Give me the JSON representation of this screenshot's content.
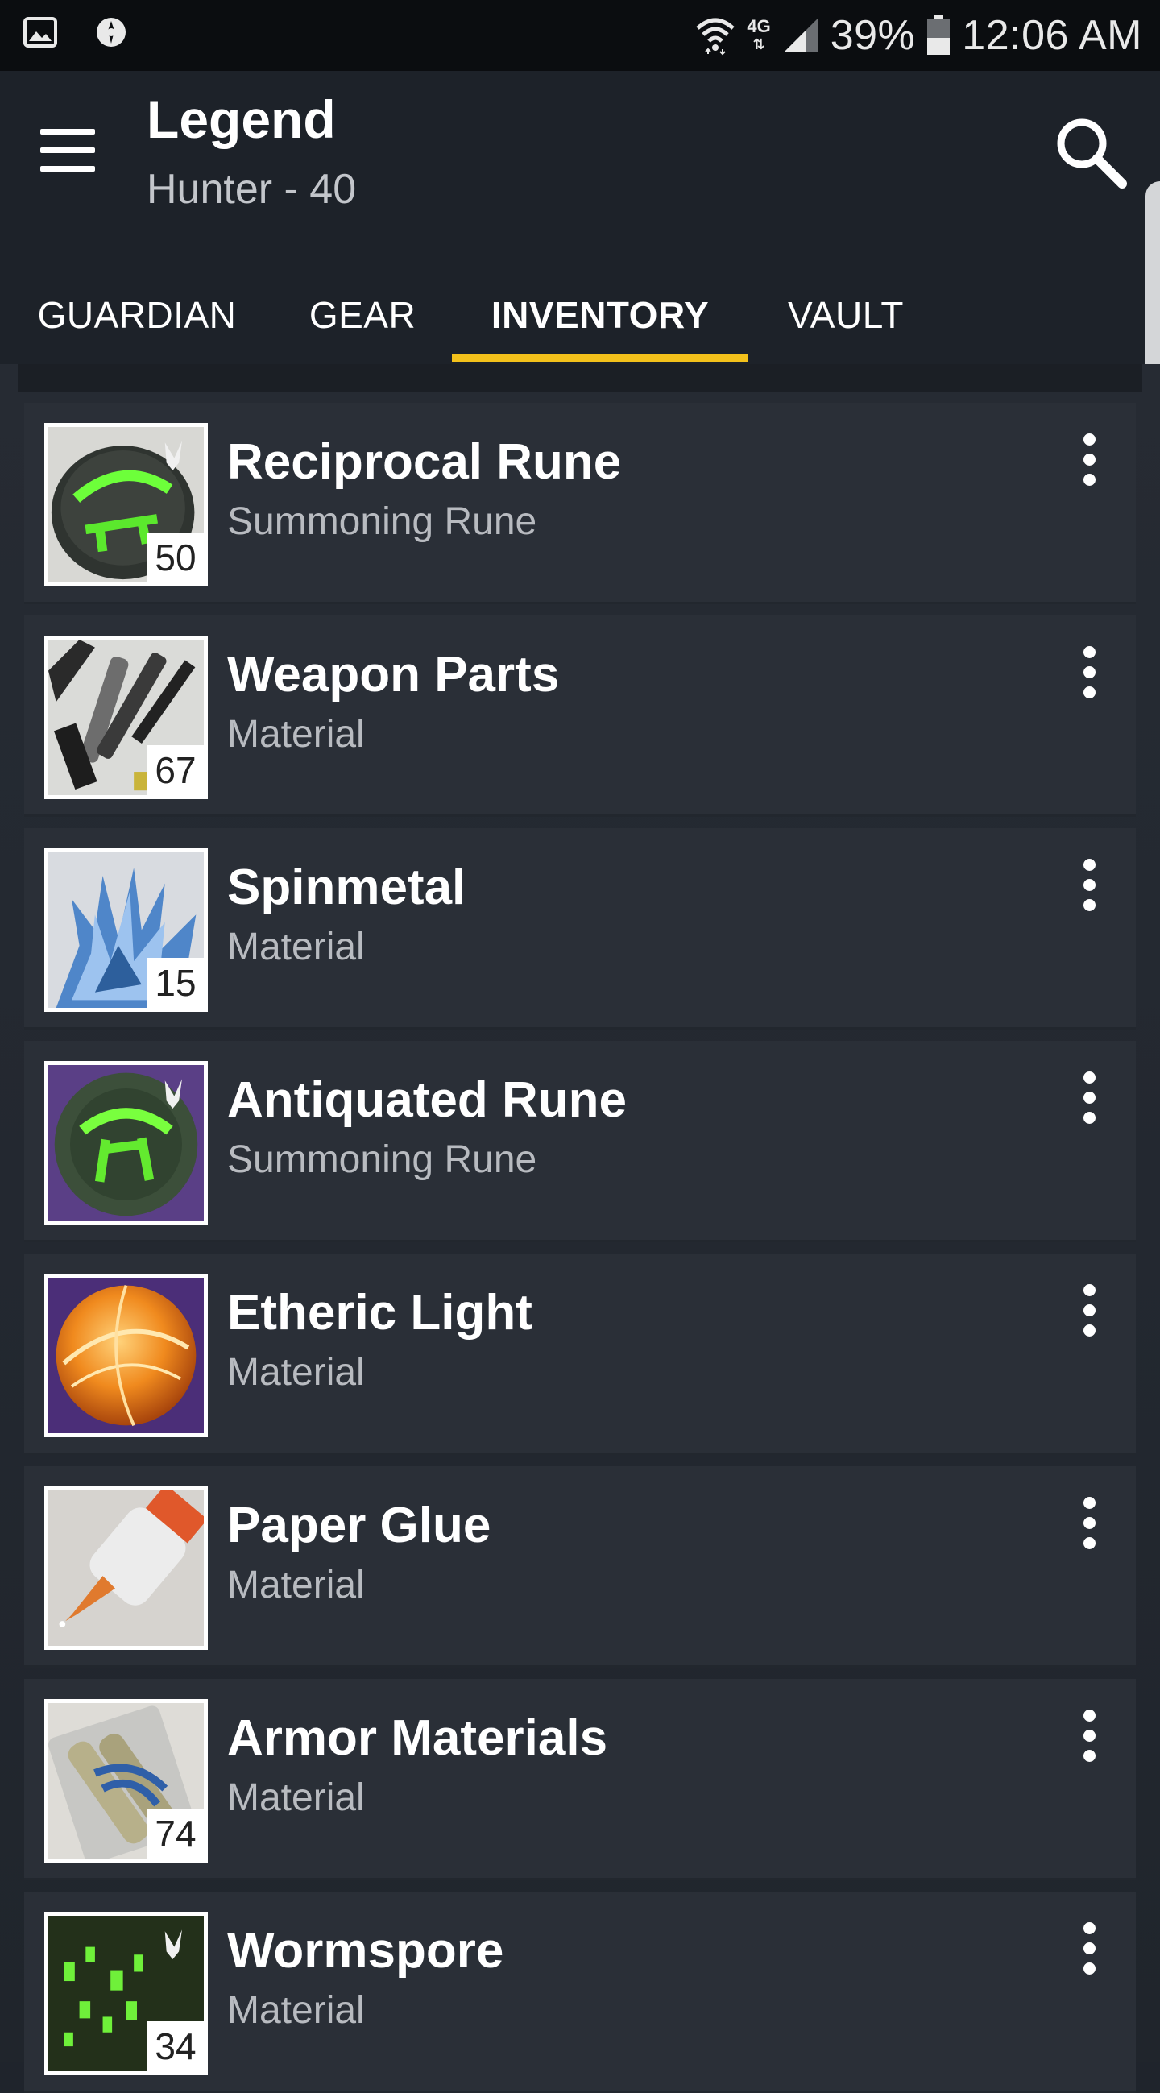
{
  "status_bar": {
    "network": "4G",
    "battery": "39%",
    "time": "12:06 AM"
  },
  "header": {
    "title": "Legend",
    "subtitle": "Hunter - 40"
  },
  "tabs": [
    {
      "label": "GUARDIAN",
      "active": false
    },
    {
      "label": "GEAR",
      "active": false
    },
    {
      "label": "INVENTORY",
      "active": true
    },
    {
      "label": "VAULT",
      "active": false
    }
  ],
  "colors": {
    "accent": "#f3c11b",
    "background": "#1f242c",
    "card": "#2a2f37"
  },
  "items": [
    {
      "name": "Reciprocal Rune",
      "type": "Summoning Rune",
      "count": "50",
      "icon": "reciprocal-rune-icon"
    },
    {
      "name": "Weapon Parts",
      "type": "Material",
      "count": "67",
      "icon": "weapon-parts-icon"
    },
    {
      "name": "Spinmetal",
      "type": "Material",
      "count": "15",
      "icon": "spinmetal-icon"
    },
    {
      "name": "Antiquated Rune",
      "type": "Summoning Rune",
      "count": "",
      "icon": "antiquated-rune-icon"
    },
    {
      "name": "Etheric Light",
      "type": "Material",
      "count": "",
      "icon": "etheric-light-icon"
    },
    {
      "name": "Paper Glue",
      "type": "Material",
      "count": "",
      "icon": "paper-glue-icon"
    },
    {
      "name": "Armor Materials",
      "type": "Material",
      "count": "74",
      "icon": "armor-materials-icon"
    },
    {
      "name": "Wormspore",
      "type": "Material",
      "count": "34",
      "icon": "wormspore-icon"
    }
  ]
}
